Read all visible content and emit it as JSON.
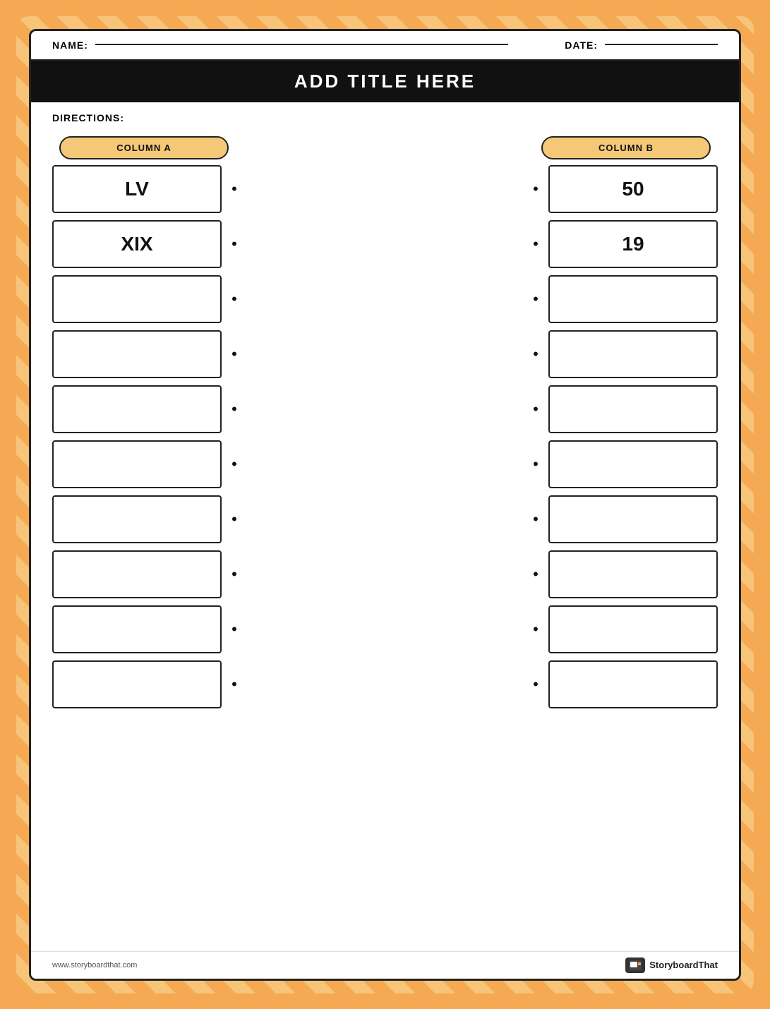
{
  "header": {
    "name_label": "NAME:",
    "date_label": "DATE:"
  },
  "title": "ADD TITLE HERE",
  "directions_label": "DIRECTIONS:",
  "column_a_label": "COLUMN A",
  "column_b_label": "COLUMN B",
  "rows": [
    {
      "col_a": "LV",
      "col_b": "50"
    },
    {
      "col_a": "XIX",
      "col_b": "19"
    },
    {
      "col_a": "",
      "col_b": ""
    },
    {
      "col_a": "",
      "col_b": ""
    },
    {
      "col_a": "",
      "col_b": ""
    },
    {
      "col_a": "",
      "col_b": ""
    },
    {
      "col_a": "",
      "col_b": ""
    },
    {
      "col_a": "",
      "col_b": ""
    },
    {
      "col_a": "",
      "col_b": ""
    },
    {
      "col_a": "",
      "col_b": ""
    }
  ],
  "footer": {
    "url": "www.storyboardthat.com",
    "brand": "StoryboardThat"
  }
}
